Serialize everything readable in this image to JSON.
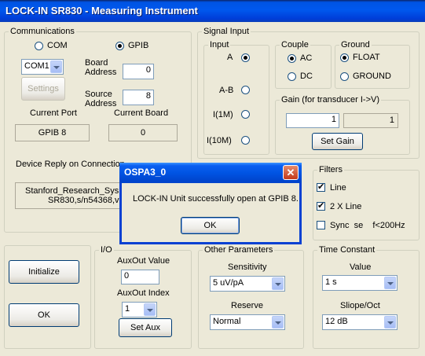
{
  "window": {
    "title": "LOCK-IN SR830 - Measuring Instrument"
  },
  "communications": {
    "legend": "Communications",
    "radio_com": "COM",
    "radio_gpib": "GPIB",
    "com_port": "COM1",
    "board_address_label": "Board\nAddress",
    "board_address_value": "0",
    "settings_label": "Settings",
    "source_address_label": "Source\nAddress",
    "source_address_value": "8",
    "current_port_label": "Current Port",
    "current_board_label": "Current Board",
    "current_port_value": "GPIB 8",
    "current_board_value": "0",
    "device_reply_label": "Device Reply on Connection",
    "device_reply_line1": "Stanford_Research_Sys",
    "device_reply_line2": "SR830,s/n54368,v"
  },
  "signal_input": {
    "legend": "Signal Input",
    "input_legend": "Input",
    "options": [
      "A",
      "A-B",
      "I(1M)",
      "I(10M)"
    ],
    "couple_legend": "Couple",
    "couple_ac": "AC",
    "couple_dc": "DC",
    "ground_legend": "Ground",
    "ground_float": "FLOAT",
    "ground_ground": "GROUND",
    "gain_legend": "Gain (for transducer I->V)",
    "gain_input": "1",
    "gain_readout": "1",
    "set_gain_label": "Set Gain"
  },
  "filters": {
    "legend": "Filters",
    "line": "Line",
    "two_x_line": "2 X Line",
    "sync": "Sync  se    f<200Hz"
  },
  "actions": {
    "initialize": "Initialize",
    "ok": "OK"
  },
  "io": {
    "legend": "I/O",
    "auxout_value_label": "AuxOut Value",
    "auxout_value": "0",
    "auxout_index_label": "AuxOut Index",
    "auxout_index": "1",
    "set_aux_label": "Set Aux"
  },
  "other_parameters": {
    "legend": "Other Parameters",
    "sensitivity_label": "Sensitivity",
    "sensitivity_value": "5 uV/pA",
    "reserve_label": "Reserve",
    "reserve_value": "Normal"
  },
  "time_constant": {
    "legend": "Time Constant",
    "value_label": "Value",
    "value": "1 s",
    "slope_label": "Sliope/Oct",
    "slope_value": "12 dB"
  },
  "dialog": {
    "title": "OSPA3_0",
    "message": "LOCK-IN Unit successfully open at GPIB 8.",
    "ok_label": "OK"
  }
}
